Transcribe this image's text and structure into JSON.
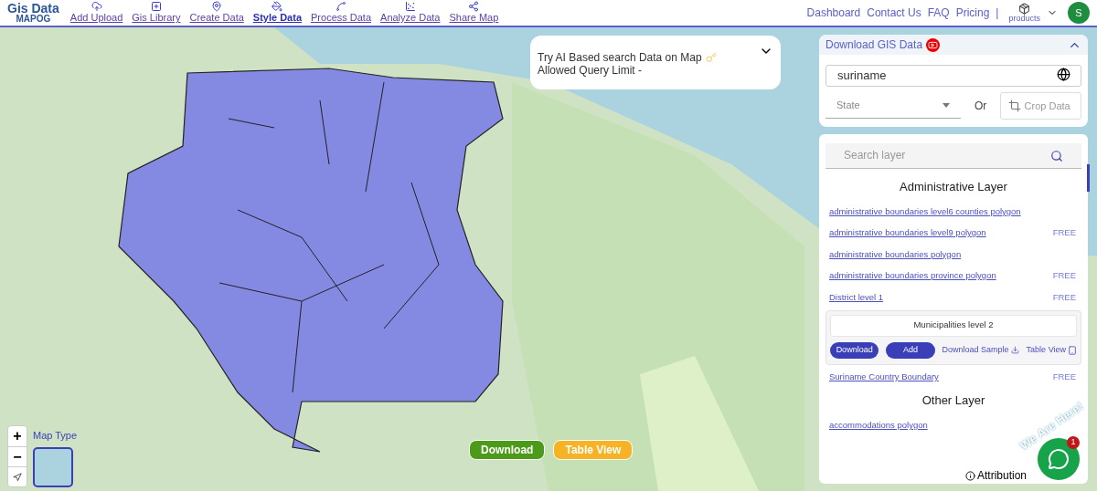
{
  "header": {
    "logo_lines": [
      "Gis Data",
      "MAPOG"
    ],
    "nav": [
      {
        "label": "Add Upload",
        "selected": false
      },
      {
        "label": "Gis Library",
        "selected": false
      },
      {
        "label": "Create Data",
        "selected": false
      },
      {
        "label": "Style Data",
        "selected": true
      },
      {
        "label": "Process Data",
        "selected": false
      },
      {
        "label": "Analyze Data",
        "selected": false
      },
      {
        "label": "Share Map",
        "selected": false
      }
    ],
    "links": [
      "Dashboard",
      "Contact Us",
      "FAQ",
      "Pricing"
    ],
    "separator": "|",
    "products": "products",
    "avatar": "S"
  },
  "ai_box": {
    "line1": "Try AI Based search Data on Map",
    "line2": "Allowed Query Limit -",
    "expanded": false
  },
  "panel": {
    "title": "Download GIS Data",
    "expanded": true,
    "search_value": "suriname",
    "state_placeholder": "State",
    "or": "Or",
    "crop": "Crop Data",
    "layer_search_placeholder": "Search layer",
    "sections": [
      {
        "heading": "Administrative Layer",
        "layers": [
          {
            "kind": "link",
            "name": "administrative boundaries level6 counties polygon"
          },
          {
            "kind": "link",
            "name": "administrative boundaries level9 polygon",
            "badge": "FREE"
          },
          {
            "kind": "link",
            "name": "administrative boundaries polygon"
          },
          {
            "kind": "link",
            "name": "administrative boundaries province polygon",
            "badge": "FREE"
          },
          {
            "kind": "link",
            "name": "District level 1",
            "badge": "FREE"
          },
          {
            "kind": "card",
            "name": "Municipalities level 2",
            "buttons": [
              "Download",
              "Add"
            ],
            "links": [
              "Download Sample",
              "Table View"
            ]
          },
          {
            "kind": "link",
            "name": "Suriname Country Boundary",
            "badge": "FREE"
          }
        ]
      },
      {
        "heading": "Other Layer",
        "layers": [
          {
            "kind": "link",
            "name": "accommodations polygon"
          }
        ]
      }
    ]
  },
  "map": {
    "map_type": "Map Type",
    "zoom_in": "+",
    "zoom_out": "−",
    "buttons": [
      "Download",
      "Table View"
    ],
    "attribution": "Attribution",
    "chat_badge": "1",
    "chat_banner": "We Are Here!"
  }
}
